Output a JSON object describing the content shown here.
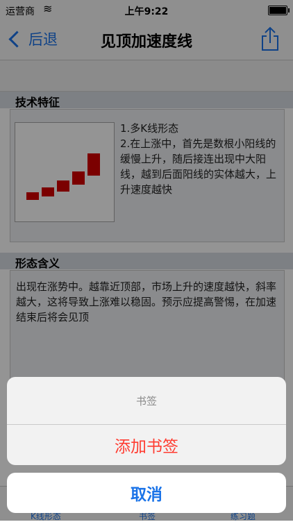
{
  "status_bar": {
    "carrier": "运营商",
    "time": "上午9:22"
  },
  "nav": {
    "back_label": "后退",
    "title": "见顶加速度线"
  },
  "sections": [
    {
      "header": "技术特征",
      "text": "1.多K线形态\n2.在上涨中，首先是数根小阳线的缓慢上升，随后接连出现中大阳线，越到后面阳线的实体越大，上升速度越快"
    },
    {
      "header": "形态含义",
      "text": "出现在涨势中。越靠近顶部，市场上升的速度越快，斜率越大，这将导致上涨难以稳固。预示应提高警惕，在加速结束后将会见顶"
    }
  ],
  "pattern_figure": {
    "color": "#d40000",
    "candles": [
      {
        "open": 0.0,
        "close": 0.09
      },
      {
        "open": 0.09,
        "close": 0.2
      },
      {
        "open": 0.2,
        "close": 0.36
      },
      {
        "open": 0.36,
        "close": 0.58
      },
      {
        "open": 0.58,
        "close": 1.0
      }
    ]
  },
  "action_sheet": {
    "title": "书签",
    "action_label": "添加书签",
    "cancel_label": "取消"
  },
  "tabbar": {
    "tabs": [
      "K线形态",
      "书签",
      "练习题"
    ]
  }
}
